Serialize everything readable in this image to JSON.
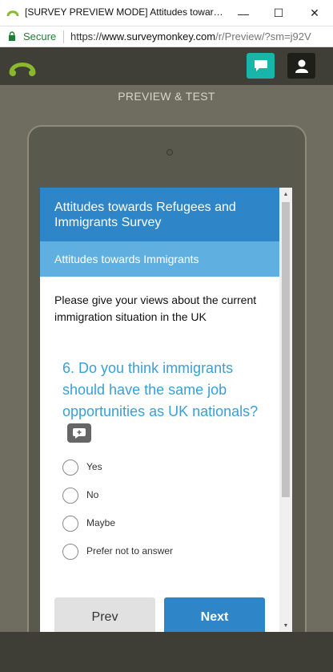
{
  "window": {
    "title": "[SURVEY PREVIEW MODE] Attitudes towards Refugees and Immigrants Survey",
    "minimize_glyph": "—",
    "maximize_glyph": "☐",
    "close_glyph": "✕"
  },
  "address_bar": {
    "secure_label": "Secure",
    "url_scheme": "https://",
    "url_host": "www.surveymonkey.com",
    "url_path": "/r/Preview/?sm=j92V"
  },
  "app_header": {
    "logo_icon": "surveymonkey-logo-icon",
    "chat_icon": "chat-icon",
    "user_icon": "user-icon",
    "accent_color": "#18b5a8"
  },
  "stage": {
    "label": "PREVIEW & TEST"
  },
  "survey": {
    "title": "Attitudes towards Refugees and Immigrants Survey",
    "page_title": "Attitudes towards Immigrants",
    "page_description": "Please give your views about the current immigration situation in the UK",
    "question": "6. Do you think immigrants should have the same job opportunities as UK nationals?",
    "comment_icon": "comment-add-icon",
    "options": [
      "Yes",
      "No",
      "Maybe",
      "Prefer not to answer"
    ],
    "prev_label": "Prev",
    "next_label": "Next",
    "primary_color": "#2e86c8",
    "band_color": "#5fb0e0"
  },
  "scrollbar": {
    "up_glyph": "▲",
    "down_glyph": "▼"
  }
}
